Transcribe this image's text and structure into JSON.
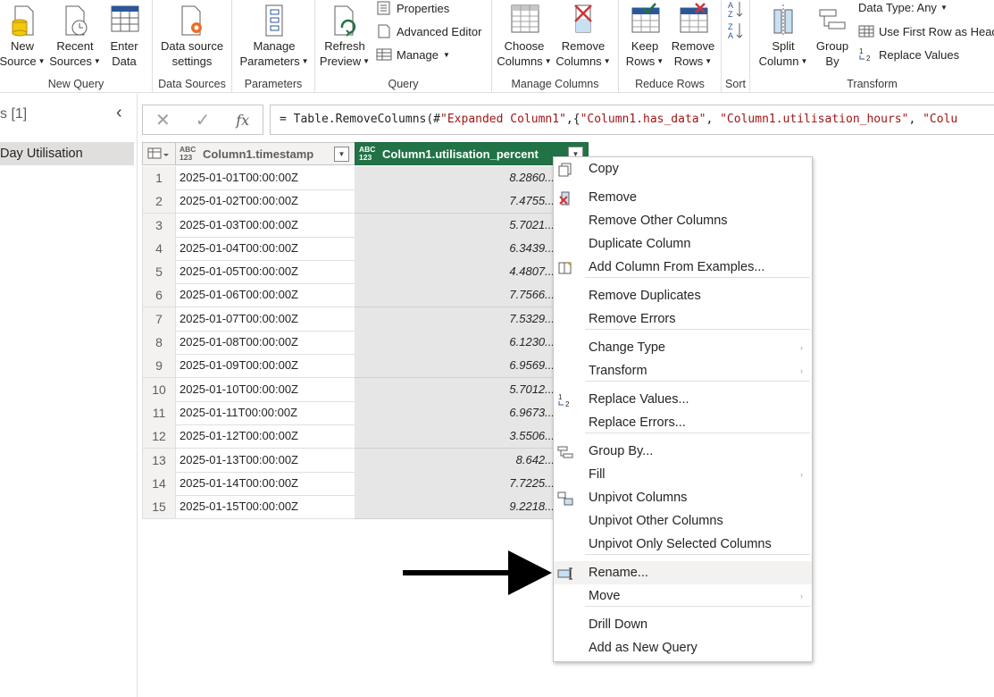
{
  "ribbon": {
    "groups": {
      "new_query": "New Query",
      "data_sources": "Data Sources",
      "parameters": "Parameters",
      "query": "Query",
      "manage_columns": "Manage Columns",
      "reduce_rows": "Reduce Rows",
      "sort": "Sort",
      "transform": "Transform"
    },
    "buttons": {
      "new_source": [
        "New",
        "Source"
      ],
      "recent_sources": [
        "Recent",
        "Sources"
      ],
      "enter_data": [
        "Enter",
        "Data"
      ],
      "data_source_settings": [
        "Data source",
        "settings"
      ],
      "manage_parameters": [
        "Manage",
        "Parameters"
      ],
      "refresh_preview": [
        "Refresh",
        "Preview"
      ],
      "properties": "Properties",
      "advanced_editor": "Advanced Editor",
      "manage": "Manage",
      "choose_columns": [
        "Choose",
        "Columns"
      ],
      "remove_columns": [
        "Remove",
        "Columns"
      ],
      "keep_rows": [
        "Keep",
        "Rows"
      ],
      "remove_rows": [
        "Remove",
        "Rows"
      ],
      "split_column": [
        "Split",
        "Column"
      ],
      "group_by": [
        "Group",
        "By"
      ],
      "data_type": "Data Type: Any",
      "use_first_row": "Use First Row as Headers",
      "replace_values": "Replace Values"
    }
  },
  "queries": {
    "title": "s [1]",
    "item": "Day Utilisation"
  },
  "formula": {
    "prefix": "= Table.RemoveColumns(#",
    "s1": "\"Expanded Column1\"",
    "mid": ",{",
    "s2": "\"Column1.has_data\"",
    "sep": ", ",
    "s3": "\"Column1.utilisation_hours\"",
    "sep2": ", ",
    "s4": "\"Colu"
  },
  "grid": {
    "type_badge": [
      "ABC",
      "123"
    ],
    "columns": [
      "Column1.timestamp",
      "Column1.utilisation_percent"
    ],
    "rows": [
      {
        "n": "1",
        "ts": "2025-01-01T00:00:00Z",
        "val": "8.2860..."
      },
      {
        "n": "2",
        "ts": "2025-01-02T00:00:00Z",
        "val": "7.4755..."
      },
      {
        "n": "3",
        "ts": "2025-01-03T00:00:00Z",
        "val": "5.7021..."
      },
      {
        "n": "4",
        "ts": "2025-01-04T00:00:00Z",
        "val": "6.3439..."
      },
      {
        "n": "5",
        "ts": "2025-01-05T00:00:00Z",
        "val": "4.4807..."
      },
      {
        "n": "6",
        "ts": "2025-01-06T00:00:00Z",
        "val": "7.7566..."
      },
      {
        "n": "7",
        "ts": "2025-01-07T00:00:00Z",
        "val": "7.5329..."
      },
      {
        "n": "8",
        "ts": "2025-01-08T00:00:00Z",
        "val": "6.1230..."
      },
      {
        "n": "9",
        "ts": "2025-01-09T00:00:00Z",
        "val": "6.9569..."
      },
      {
        "n": "10",
        "ts": "2025-01-10T00:00:00Z",
        "val": "5.7012..."
      },
      {
        "n": "11",
        "ts": "2025-01-11T00:00:00Z",
        "val": "6.9673..."
      },
      {
        "n": "12",
        "ts": "2025-01-12T00:00:00Z",
        "val": "3.5506..."
      },
      {
        "n": "13",
        "ts": "2025-01-13T00:00:00Z",
        "val": "8.642..."
      },
      {
        "n": "14",
        "ts": "2025-01-14T00:00:00Z",
        "val": "7.7225..."
      },
      {
        "n": "15",
        "ts": "2025-01-15T00:00:00Z",
        "val": "9.2218..."
      }
    ]
  },
  "menu": {
    "items": [
      "Copy",
      "Remove",
      "Remove Other Columns",
      "Duplicate Column",
      "Add Column From Examples...",
      "Remove Duplicates",
      "Remove Errors",
      "Change Type",
      "Transform",
      "Replace Values...",
      "Replace Errors...",
      "Group By...",
      "Fill",
      "Unpivot Columns",
      "Unpivot Other Columns",
      "Unpivot Only Selected Columns",
      "Rename...",
      "Move",
      "Drill Down",
      "Add as New Query"
    ],
    "highlighted": "Rename..."
  },
  "colors": {
    "accent": "#217346",
    "selected_column_bg": "#e6e6e6",
    "menu_highlight": "#f3f2f1"
  }
}
